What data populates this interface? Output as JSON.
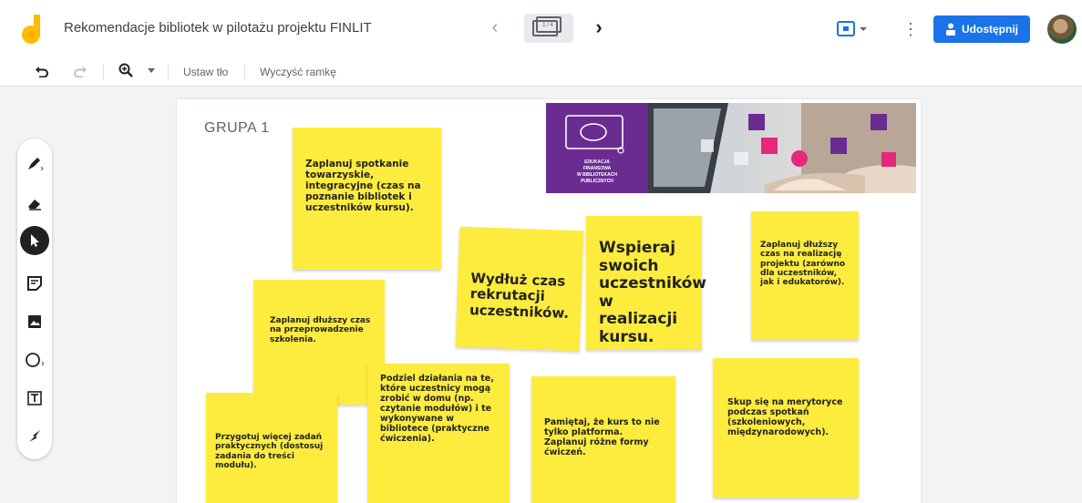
{
  "header": {
    "title": "Rekomendacje bibliotek w pilotażu projektu FINLIT",
    "frame_counter": "1 / 4",
    "share_label": "Udostępnij"
  },
  "toolbar": {
    "set_background": "Ustaw tło",
    "clear_frame": "Wyczyść ramkę"
  },
  "tools": [
    "pen-icon",
    "eraser-icon",
    "select-icon",
    "sticky-note-icon",
    "image-icon",
    "circle-icon",
    "text-box-icon",
    "laser-icon"
  ],
  "canvas": {
    "heading": "GRUPA 1",
    "banner": {
      "line1": "EDUKACJA",
      "line2": "FINANSOWA",
      "line3": "W BIBLIOTEKACH",
      "line4": "PUBLICZNYCH"
    },
    "notes": [
      "Zaplanuj spotkanie towarzyskie, integracyjne (czas na poznanie bibliotek i uczestników kursu).",
      "Wydłuż czas rekrutacji uczestników.",
      "Wspieraj swoich uczestników w realizacji kursu.",
      "Zaplanuj dłuższy czas na realizację projektu (zarówno dla uczestników, jak i edukatorów).",
      "Zaplanuj dłuższy czas na przeprowadzenie szkolenia.",
      "Przygotuj więcej zadań praktycznych (dostosuj zadania do treści modułu).",
      "Podziel działania na te, które uczestnicy mogą zrobić w domu (np. czytanie modułów) i te wykonywane w bibliotece (praktyczne ćwiczenia).",
      "Pamiętaj, że kurs to nie tylko platforma. Zaplanuj różne formy ćwiczeń.",
      "Skup się na merytoryce podczas spotkań (szkoleniowych, międzynarodowych)."
    ]
  },
  "colors": {
    "accent": "#1a73e8",
    "sticky": "#fdec3e",
    "banner_purple": "#6b2c91",
    "banner_pink": "#e6287a"
  }
}
